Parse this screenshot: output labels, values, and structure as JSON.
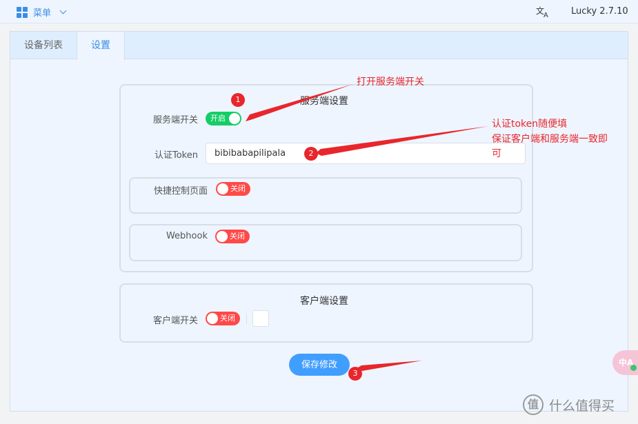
{
  "header": {
    "menu_label": "菜单",
    "version": "Lucky 2.7.10",
    "icons": [
      "grid-icon",
      "chevron-down-icon",
      "translate-icon"
    ]
  },
  "tabs": [
    {
      "label": "设备列表",
      "active": false
    },
    {
      "label": "设置",
      "active": true
    }
  ],
  "server": {
    "title": "服务端设置",
    "switch_label": "服务端开关",
    "switch_state": "开启",
    "token_label": "认证Token",
    "token_value": "bibibabapilipala",
    "quick_label": "快捷控制页面",
    "quick_state": "关闭",
    "webhook_label": "Webhook",
    "webhook_state": "关闭"
  },
  "client": {
    "title": "客户端设置",
    "switch_label": "客户端开关",
    "switch_state": "关闭"
  },
  "save_label": "保存修改",
  "annotations": {
    "note1": "打开服务端开关",
    "note2_line1": "认证token随便填",
    "note2_line2": "保证客户端和服务端一致即",
    "note2_line3": "可",
    "badge1": "1",
    "badge2": "2",
    "badge3": "3",
    "color": "#e8262b"
  },
  "floating_button": {
    "text": "中A",
    "icon": "translate-float-icon"
  },
  "watermark": {
    "logo": "值",
    "text": "什么值得买"
  },
  "colors": {
    "primary": "#409eff",
    "on": "#13ce66",
    "off": "#ff4949"
  }
}
